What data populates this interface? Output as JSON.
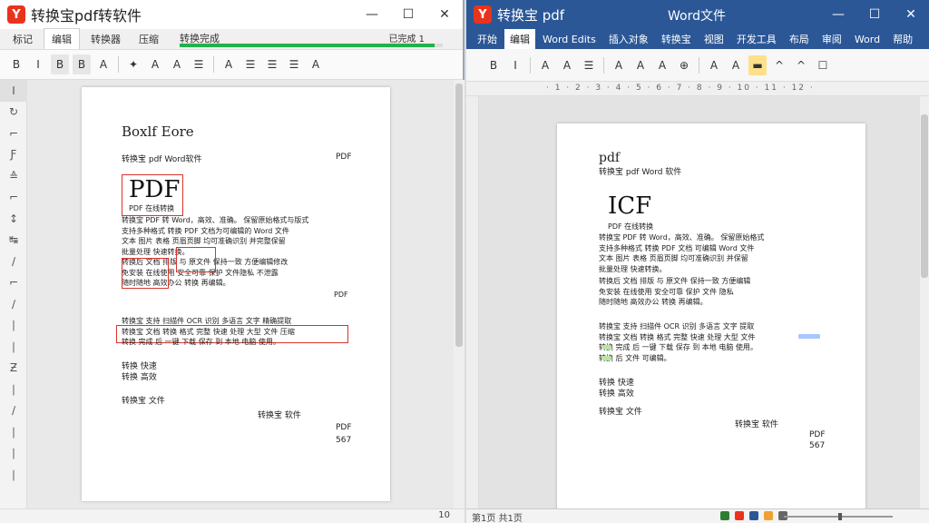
{
  "left": {
    "app_title": "转换宝pdf转软件",
    "logo_letter": "Y",
    "tabs": [
      "标记",
      "编辑",
      "转换器",
      "压缩"
    ],
    "active_tab_index": 1,
    "status_label": "转换完成",
    "progress_label": "已完成 1",
    "progress_fraction": 0.97,
    "toolbar": [
      "B",
      "I",
      "B",
      "B",
      "A",
      "✦",
      "A",
      "A",
      "☰",
      "A",
      "☰",
      "☰",
      "☰",
      "A"
    ],
    "side_icons": [
      "cursor-icon",
      "select-icon",
      "text-icon",
      "font-icon",
      "stamp-icon",
      "crop-icon",
      "measure-icon",
      "link-icon",
      "pen-icon",
      "shape-icon",
      "line-icon",
      "note-icon",
      "zoom-icon",
      "hand-icon",
      "rotate-icon",
      "ruler-icon",
      "mark-icon",
      "erase-icon",
      "arrow-icon"
    ],
    "page_indicator": "10",
    "doc": {
      "logo_text": "Boxlf Eore",
      "sub_heading": "转换宝 pdf Word软件",
      "header_right": "PDF",
      "title": "PDF",
      "section_label": "PDF 在线转换",
      "para1": [
        "转换宝 PDF 转 Word，高效、准确。 保留原始格式与版式",
        "支持多种格式 转换 PDF 文档为可编辑的 Word 文件",
        "文本 图片 表格 页眉页脚 均可准确识别 并完整保留",
        "批量处理 快速转换。",
        "转换后 文档 排版 与 原文件 保持一致 方便编辑修改",
        "免安装 在线使用 安全可靠 保护 文件隐私 不泄露",
        "随时随地 高效办公 转换 再编辑。"
      ],
      "para1_right": "PDF",
      "para2": [
        "转换宝 支持 扫描件 OCR 识别 多语言 文字 精确提取",
        "转换宝 文档 转换 格式 完整 快速 处理 大型 文件 压缩",
        "转换 完成 后 一键 下载 保存 到 本地 电脑 使用。"
      ],
      "list": [
        "转换 快速",
        "转换 高效"
      ],
      "footer_label": "转换宝 文件",
      "center_label": "转换宝 软件",
      "page_num_a": "PDF",
      "page_num_b": "567"
    }
  },
  "right": {
    "app_title": "转换宝 pdf",
    "logo_letter": "Y",
    "doc_title": "Word文件",
    "ribbon_tabs": [
      "开始",
      "编辑",
      "Word Edits",
      "插入对象",
      "转换宝",
      "视图",
      "开发工具",
      "布局",
      "审阅",
      "Word",
      "帮助"
    ],
    "active_tab_index": 1,
    "toolbar": [
      "B",
      "I",
      "A",
      "A",
      "☰",
      "A",
      "A",
      "A",
      "⊕",
      "A",
      "A",
      "▬",
      "^",
      "^",
      "☐"
    ],
    "ruler_text": "· 1 · 2 · 3 · 4 · 5 · 6 · 7 · 8 · 9 · 10 · 11 · 12 ·",
    "status_page": "第1页 共1页",
    "status_icon_colors": [
      "#2e7d32",
      "#e8341c",
      "#2b5797",
      "#f0a030",
      "#666666"
    ],
    "doc": {
      "logo_text": "pdf",
      "sub_heading": "转换宝 pdf Word 软件",
      "title": "ICF",
      "section_label": "PDF 在线转换",
      "para1": [
        "转换宝 PDF 转 Word，高效、准确。 保留原始格式",
        "支持多种格式 转换 PDF 文档 可编辑 Word 文件",
        "文本 图片 表格 页眉页脚 均可准确识别 并保留",
        "批量处理 快速转换。"
      ],
      "para2": [
        "转换后 文档 排版 与 原文件 保持一致 方便编辑",
        "免安装 在线使用 安全可靠 保护 文件 隐私",
        "随时随地 高效办公 转换 再编辑。"
      ],
      "para3": [
        "转换宝 支持 扫描件 OCR 识别 多语言 文字 提取",
        "转换宝 文档 转换 格式 完整 快速 处理 大型 文件",
        "转换 完成 后 一键 下载 保存 到 本地 电脑 使用。",
        "转换 后 文件 可编辑。"
      ],
      "list": [
        "转换 快速",
        "转换 高效"
      ],
      "footer_label": "转换宝 文件",
      "center_label": "转换宝 软件",
      "page_num_a": "PDF",
      "page_num_b": "567"
    }
  }
}
